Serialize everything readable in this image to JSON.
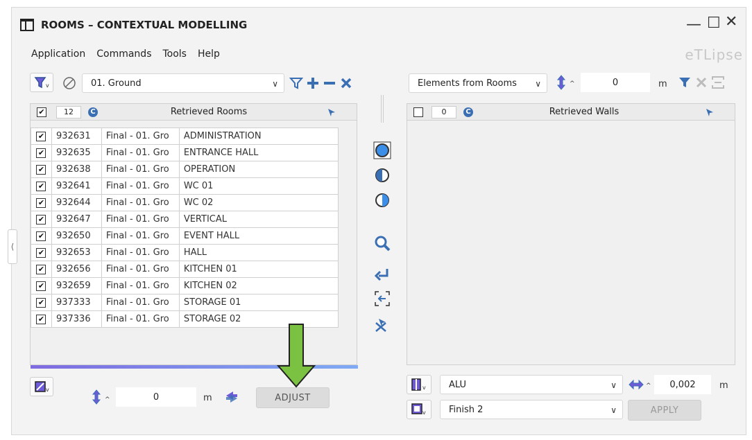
{
  "window": {
    "title": "ROOMS – CONTEXTUAL MODELLING",
    "brand": "eTLipse"
  },
  "menu": [
    "Application",
    "Commands",
    "Tools",
    "Help"
  ],
  "left": {
    "level_select": "01. Ground",
    "count": "12",
    "header": "Retrieved Rooms",
    "rows": [
      {
        "id": "932631",
        "level": "Final - 01. Gro",
        "name": "ADMINISTRATION"
      },
      {
        "id": "932635",
        "level": "Final - 01. Gro",
        "name": "ENTRANCE HALL"
      },
      {
        "id": "932638",
        "level": "Final - 01. Gro",
        "name": "OPERATION"
      },
      {
        "id": "932641",
        "level": "Final - 01. Gro",
        "name": "WC 01"
      },
      {
        "id": "932644",
        "level": "Final - 01. Gro",
        "name": "WC 02"
      },
      {
        "id": "932647",
        "level": "Final - 01. Gro",
        "name": "VERTICAL"
      },
      {
        "id": "932650",
        "level": "Final - 01. Gro",
        "name": "EVENT HALL"
      },
      {
        "id": "932653",
        "level": "Final - 01. Gro",
        "name": "HALL"
      },
      {
        "id": "932656",
        "level": "Final - 01. Gro",
        "name": "KITCHEN 01"
      },
      {
        "id": "932659",
        "level": "Final - 01. Gro",
        "name": "KITCHEN 02"
      },
      {
        "id": "937333",
        "level": "Final - 01. Gro",
        "name": "STORAGE 01"
      },
      {
        "id": "937336",
        "level": "Final - 01. Gro",
        "name": "STORAGE 02"
      }
    ],
    "offset_value": "0",
    "offset_unit": "m",
    "adjust_label": "ADJUST"
  },
  "right": {
    "source_select": "Elements from Rooms",
    "offset_value": "0",
    "offset_unit": "m",
    "count": "0",
    "header": "Retrieved Walls",
    "material_select": "ALU",
    "thickness_value": "0,002",
    "thickness_unit": "m",
    "finish_select": "Finish 2",
    "apply_label": "APPLY"
  },
  "colors": {
    "accent": "#3b6fb4",
    "arrow": "#7bc142",
    "purple": "#6e5bd8"
  }
}
